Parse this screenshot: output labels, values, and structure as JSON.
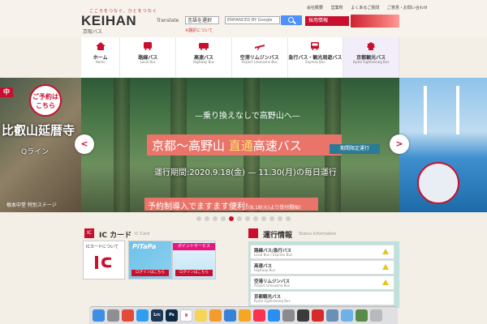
{
  "header": {
    "logo_tagline": "こころをつなぐ、ひとをつなぐ",
    "logo_main": "KEIHAN",
    "logo_sub": "京阪バス",
    "translate_label": "Translate",
    "language_select": "言語を選択",
    "search_placeholder": "ENHANCED BY Google",
    "translation_note": "※翻訳について",
    "utility_links": [
      "会社概要",
      "営業所",
      "よくあるご質問",
      "ご意見・お問い合わせ"
    ],
    "recruit_label": "採用情報"
  },
  "nav": [
    {
      "label": "ホーム",
      "sub": "Home"
    },
    {
      "label": "路線バス",
      "sub": "Local Bus"
    },
    {
      "label": "高速バス",
      "sub": "Highway Bus"
    },
    {
      "label": "空港リムジンバス",
      "sub": "Airport Limousine Bus"
    },
    {
      "label": "急行バス・観光周遊バス",
      "sub": "Express Bus"
    },
    {
      "label": "京都観光バス",
      "sub": "Kyoto Sightseeing Bus"
    }
  ],
  "hero": {
    "left_badge_mark": "中",
    "left_badge": "ご予約はこちら",
    "left_title": "比叡山延暦寺",
    "left_line": "Qライン",
    "left_caption": "根本中堂 特別ステージ",
    "slogan": "—乗り換えなしで高野山へ—",
    "main_before": "京都〜高野山 ",
    "main_highlight": "直通",
    "main_after": "高速バス",
    "limited": "期間限定運行",
    "period": "運行期間:2020.9.18(金) — 11.30(月)の毎日運行",
    "reservation": "予約制導入でますます便利!",
    "reservation_small": "(8.18(火)より受付開始)",
    "prev_icon": "chevron-left-icon",
    "next_icon": "chevron-right-icon",
    "dot_count": 12,
    "active_dot": 4
  },
  "ic_section": {
    "box": "IC",
    "title": "IC カード",
    "sub": "IC Card",
    "card1_label": "ICカードについて",
    "card2_label": "PiTaPa",
    "card2_login": "ログインはこちら",
    "card3_label": "ポイントサービス",
    "card3_login": "ログインはこちら"
  },
  "operation": {
    "title": "運行情報",
    "sub": "Status Information",
    "rows": [
      {
        "name": "路線バス/急行バス",
        "en": "Local Bus / Express Bus"
      },
      {
        "name": "高速バス",
        "en": "Highway Bus"
      },
      {
        "name": "空港リムジンバス",
        "en": "Airport Limousine Bus"
      },
      {
        "name": "京都観光バス",
        "en": "Kyoto Sightseeing Bus"
      }
    ]
  },
  "dock": [
    {
      "icon": "finder-icon",
      "color": "#3d8fe3"
    },
    {
      "icon": "launchpad-icon",
      "color": "#8e8e93"
    },
    {
      "icon": "chrome-icon",
      "color": "#e04b3a"
    },
    {
      "icon": "safari-icon",
      "color": "#2f9ef0"
    },
    {
      "icon": "lightroom-icon",
      "color": "#1c3a56",
      "text": "Lrc"
    },
    {
      "icon": "photoshop-icon",
      "color": "#0b2b45",
      "text": "Ps"
    },
    {
      "icon": "calendar-icon",
      "color": "#ffffff",
      "text": "9"
    },
    {
      "icon": "notes-icon",
      "color": "#f6d45a"
    },
    {
      "icon": "photos-icon",
      "color": "#f49b2e"
    },
    {
      "icon": "keynote-icon",
      "color": "#3a82d6"
    },
    {
      "icon": "pages-icon",
      "color": "#f5a623"
    },
    {
      "icon": "music-icon",
      "color": "#fa3355"
    },
    {
      "icon": "appstore-icon",
      "color": "#2b8ef0"
    },
    {
      "icon": "settings-icon",
      "color": "#8a8a8f"
    },
    {
      "icon": "printer-icon",
      "color": "#3b3b3b"
    },
    {
      "icon": "acrobat-icon",
      "color": "#d62b2b"
    },
    {
      "icon": "preview-icon",
      "color": "#6c8fb6"
    },
    {
      "icon": "folder-icon",
      "color": "#6cb2e8"
    },
    {
      "icon": "image-icon",
      "color": "#5a8a4a"
    },
    {
      "icon": "trash-icon",
      "color": "#b8b8bd"
    }
  ]
}
